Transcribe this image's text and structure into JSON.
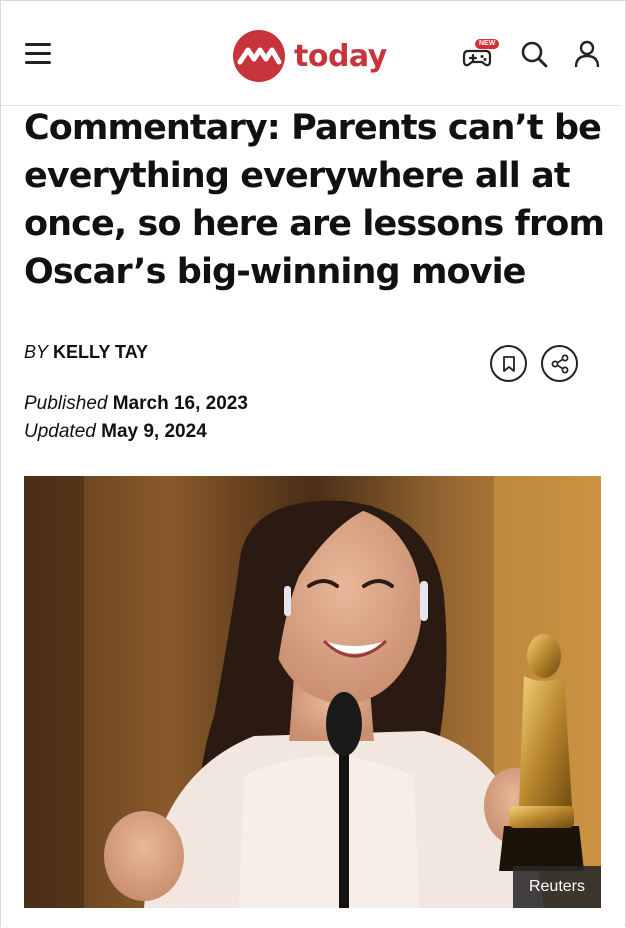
{
  "header": {
    "logo_text": "today",
    "games_badge": "NEW",
    "brand_color": "#c8343b",
    "icons": [
      "menu-icon",
      "games-controller-icon",
      "search-icon",
      "user-icon"
    ]
  },
  "article": {
    "headline": "Commentary: Parents can’t be everything everywhere all at once, so here are lessons from Oscar’s big-winning movie",
    "byline_prefix": "BY",
    "author": "KELLY TAY",
    "published_label": "Published",
    "published_date": "March 16, 2023",
    "updated_label": "Updated",
    "updated_date": "May 9, 2024",
    "actions": [
      "bookmark-icon",
      "share-icon"
    ],
    "image_credit": "Reuters"
  }
}
